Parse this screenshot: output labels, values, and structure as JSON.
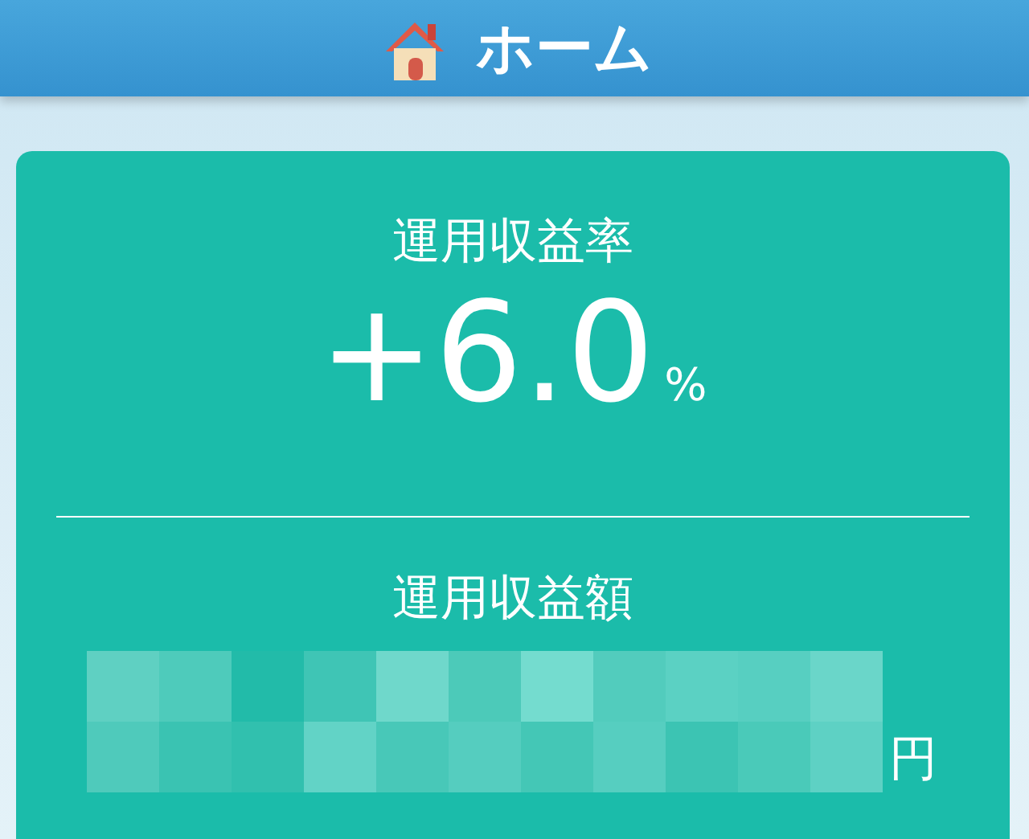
{
  "header": {
    "title": "ホーム"
  },
  "return_rate": {
    "label": "運用収益率",
    "value": "+6.0",
    "unit": "%"
  },
  "return_amount": {
    "label": "運用収益額",
    "unit": "円"
  }
}
